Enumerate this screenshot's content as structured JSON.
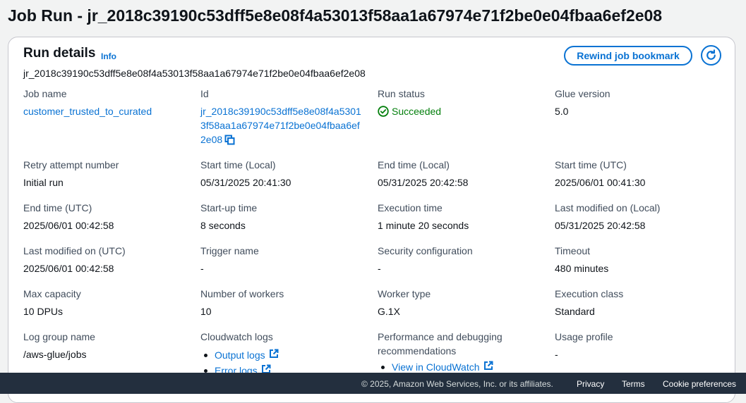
{
  "page": {
    "title": "Job Run - jr_2018c39190c53dff5e8e08f4a53013f58aa1a67974e71f2be0e04fbaa6ef2e08"
  },
  "card": {
    "title": "Run details",
    "info": "Info",
    "run_id": "jr_2018c39190c53dff5e8e08f4a53013f58aa1a67974e71f2be0e04fbaa6ef2e08",
    "rewind_label": "Rewind job bookmark",
    "refresh_icon": "refresh-icon"
  },
  "fields": {
    "job_name": {
      "label": "Job name",
      "value": "customer_trusted_to_curated"
    },
    "id": {
      "label": "Id",
      "value": "jr_2018c39190c53dff5e8e08f4a53013f58aa1a67974e71f2be0e04fbaa6ef2e08"
    },
    "run_status": {
      "label": "Run status",
      "value": "Succeeded",
      "color": "#037f0c"
    },
    "glue_version": {
      "label": "Glue version",
      "value": "5.0"
    },
    "retry": {
      "label": "Retry attempt number",
      "value": "Initial run"
    },
    "start_local": {
      "label": "Start time (Local)",
      "value": "05/31/2025 20:41:30"
    },
    "end_local": {
      "label": "End time (Local)",
      "value": "05/31/2025 20:42:58"
    },
    "start_utc": {
      "label": "Start time (UTC)",
      "value": "2025/06/01 00:41:30"
    },
    "end_utc": {
      "label": "End time (UTC)",
      "value": "2025/06/01 00:42:58"
    },
    "startup": {
      "label": "Start-up time",
      "value": "8 seconds"
    },
    "execution": {
      "label": "Execution time",
      "value": "1 minute 20 seconds"
    },
    "modified_local": {
      "label": "Last modified on (Local)",
      "value": "05/31/2025 20:42:58"
    },
    "modified_utc": {
      "label": "Last modified on (UTC)",
      "value": "2025/06/01 00:42:58"
    },
    "trigger": {
      "label": "Trigger name",
      "value": "-"
    },
    "security": {
      "label": "Security configuration",
      "value": "-"
    },
    "timeout": {
      "label": "Timeout",
      "value": "480 minutes"
    },
    "max_capacity": {
      "label": "Max capacity",
      "value": "10 DPUs"
    },
    "workers": {
      "label": "Number of workers",
      "value": "10"
    },
    "worker_type": {
      "label": "Worker type",
      "value": "G.1X"
    },
    "exec_class": {
      "label": "Execution class",
      "value": "Standard"
    },
    "log_group": {
      "label": "Log group name",
      "value": "/aws-glue/jobs"
    },
    "cloudwatch": {
      "label": "Cloudwatch logs",
      "links": [
        "Output logs",
        "Error logs"
      ]
    },
    "perf": {
      "label": "Performance and debugging recommendations",
      "links": [
        "View in CloudWatch"
      ]
    },
    "usage": {
      "label": "Usage profile",
      "value": "-"
    }
  },
  "footer": {
    "copyright": "© 2025, Amazon Web Services, Inc. or its affiliates.",
    "privacy": "Privacy",
    "terms": "Terms",
    "cookies": "Cookie preferences"
  },
  "colors": {
    "accent": "#0972d3",
    "success": "#037f0c",
    "footer_bg": "#232f3e"
  }
}
